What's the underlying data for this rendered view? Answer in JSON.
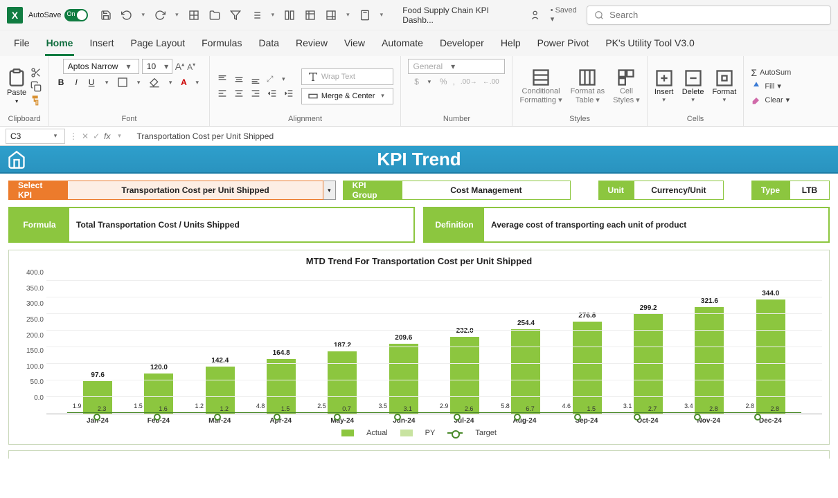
{
  "titlebar": {
    "autosave": "AutoSave",
    "switch": "On",
    "doc": "Food Supply Chain KPI Dashb...",
    "saved": "• Saved ▾",
    "search_placeholder": "Search"
  },
  "tabs": [
    "File",
    "Home",
    "Insert",
    "Page Layout",
    "Formulas",
    "Data",
    "Review",
    "View",
    "Automate",
    "Developer",
    "Help",
    "Power Pivot",
    "PK's Utility Tool V3.0"
  ],
  "active_tab": 1,
  "ribbon": {
    "paste": "Paste",
    "clipboard": "Clipboard",
    "font_name": "Aptos Narrow",
    "font_size": "10",
    "font": "Font",
    "wrap": "Wrap Text",
    "merge": "Merge & Center",
    "alignment": "Alignment",
    "number_format": "General",
    "number": "Number",
    "cond": "Conditional Formatting",
    "table": "Format as Table",
    "cellstyles": "Cell Styles",
    "styles": "Styles",
    "insert": "Insert",
    "delete": "Delete",
    "format": "Format",
    "cells": "Cells",
    "autosum": "AutoSum",
    "fill": "Fill",
    "clear": "Clear"
  },
  "formula_bar": {
    "cell": "C3",
    "value": "Transportation Cost per Unit Shipped"
  },
  "banner": "KPI Trend",
  "controls": {
    "select_kpi_label": "Select KPI",
    "select_kpi_value": "Transportation Cost per Unit Shipped",
    "kpi_group_label": "KPI Group",
    "kpi_group_value": "Cost Management",
    "unit_label": "Unit",
    "unit_value": "Currency/Unit",
    "type_label": "Type",
    "type_value": "LTB"
  },
  "info": {
    "formula_label": "Formula",
    "formula_value": "Total Transportation Cost / Units Shipped",
    "definition_label": "Definition",
    "definition_value": "Average cost of transporting each unit of product"
  },
  "chart_data": {
    "type": "bar",
    "title": "MTD Trend For Transportation Cost per Unit Shipped",
    "ylim": [
      0,
      400
    ],
    "yticks": [
      "400.0",
      "350.0",
      "300.0",
      "250.0",
      "200.0",
      "150.0",
      "100.0",
      "50.0",
      "0.0"
    ],
    "categories": [
      "Jan-24",
      "Feb-24",
      "Mar-24",
      "Apr-24",
      "May-24",
      "Jun-24",
      "Jul-24",
      "Aug-24",
      "Sep-24",
      "Oct-24",
      "Nov-24",
      "Dec-24"
    ],
    "series": [
      {
        "name": "Actual",
        "values": [
          97.6,
          120.0,
          142.4,
          164.8,
          187.2,
          209.6,
          232.0,
          254.4,
          276.8,
          299.2,
          321.6,
          344.0
        ]
      },
      {
        "name": "PY",
        "values": [
          1.9,
          1.5,
          1.2,
          4.8,
          2.5,
          3.5,
          2.9,
          5.8,
          4.6,
          3.1,
          3.4,
          2.8
        ]
      },
      {
        "name": "Target",
        "values": [
          2.3,
          1.6,
          1.2,
          1.5,
          0.7,
          3.1,
          2.6,
          6.7,
          1.5,
          2.7,
          2.8,
          2.8
        ]
      }
    ],
    "legend": [
      "Actual",
      "PY",
      "Target"
    ]
  }
}
